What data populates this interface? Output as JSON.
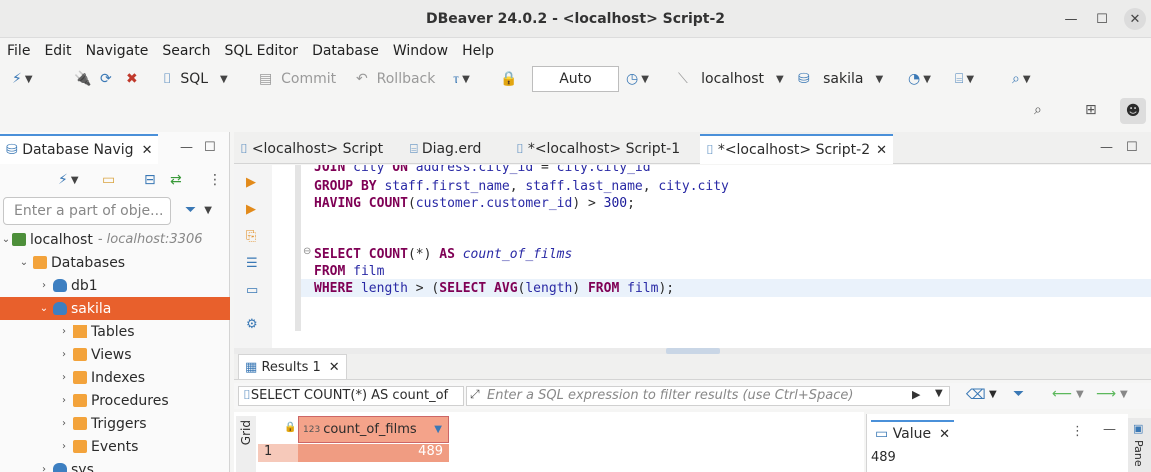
{
  "window": {
    "title": "DBeaver 24.0.2 - <localhost> Script-2"
  },
  "menu": [
    "File",
    "Edit",
    "Navigate",
    "Search",
    "SQL Editor",
    "Database",
    "Window",
    "Help"
  ],
  "toolbar": {
    "sql_label": "SQL",
    "commit_label": "Commit",
    "rollback_label": "Rollback",
    "transaction_mode": "Auto",
    "connection": "localhost",
    "schema": "sakila"
  },
  "navigator": {
    "tab_label": "Database Navig",
    "filter_placeholder": "Enter a part of obje...",
    "tree": {
      "connection": "localhost",
      "connection_detail": " - localhost:3306",
      "databases": "Databases",
      "db1": "db1",
      "sakila": "sakila",
      "tables": "Tables",
      "views": "Views",
      "indexes": "Indexes",
      "procedures": "Procedures",
      "triggers": "Triggers",
      "events": "Events",
      "sys": "sys"
    }
  },
  "editor": {
    "tabs": [
      "<localhost> Script",
      "Diag.erd",
      "*<localhost> Script-1",
      "*<localhost> Script-2"
    ],
    "code_partial_top": "JOIN city ON address.city_id = city.city_id"
  },
  "results": {
    "tab_label": "Results 1",
    "query_text": "SELECT COUNT(*) AS count_of",
    "filter_placeholder": "Enter a SQL expression to filter results (use Ctrl+Space)",
    "grid_label": "Grid",
    "column_type": "123",
    "column_header": "count_of_films",
    "row_number": "1",
    "cell_value": "489"
  },
  "value_panel": {
    "tab_label": "Value",
    "value": "489",
    "side_label": "Pane"
  }
}
